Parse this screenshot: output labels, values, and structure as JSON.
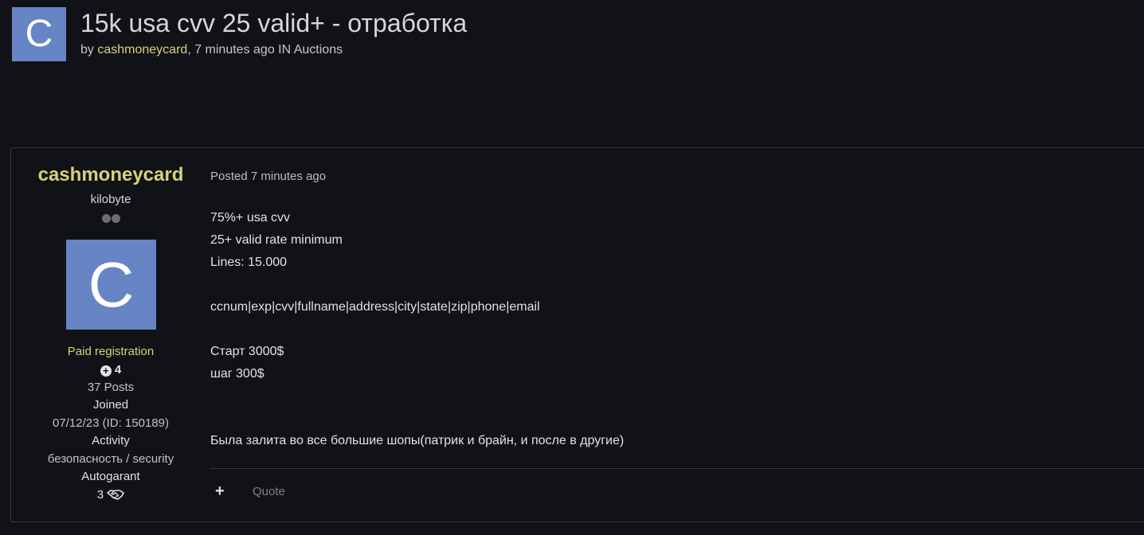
{
  "topic": {
    "avatar_letter": "C",
    "title": "15k usa cvv 25 valid+ - отработка",
    "by_label": "by",
    "author": "cashmoneycard",
    "meta_suffix": ", 7 minutes ago IN Auctions"
  },
  "post": {
    "author": {
      "name": "cashmoneycard",
      "rank": "kilobyte",
      "avatar_letter": "C",
      "group": "Paid registration",
      "reputation": "4",
      "posts": "37 Posts",
      "joined_label": "Joined",
      "joined_value": "07/12/23 (ID: 150189)",
      "activity_label": "Activity",
      "activity_value": "безопасность / security",
      "autogarant_label": "Autogarant",
      "autogarant_value": "3"
    },
    "posted": "Posted 7 minutes ago",
    "content": [
      "75%+ usa cvv",
      "25+ valid rate minimum",
      "Lines: 15.000",
      "",
      "ccnum|exp|cvv|fullname|address|city|state|zip|phone|email",
      "",
      "Старт 3000$",
      "шаг 300$",
      "",
      "",
      "Была залита во все большие шопы(патрик и брайн, и после в другие)"
    ],
    "actions": {
      "plus": "+",
      "quote": "Quote"
    }
  },
  "colors": {
    "background": "#111217",
    "accent_yellow": "#d6d27a",
    "avatar_blue": "#6784c5",
    "border": "#343741"
  }
}
